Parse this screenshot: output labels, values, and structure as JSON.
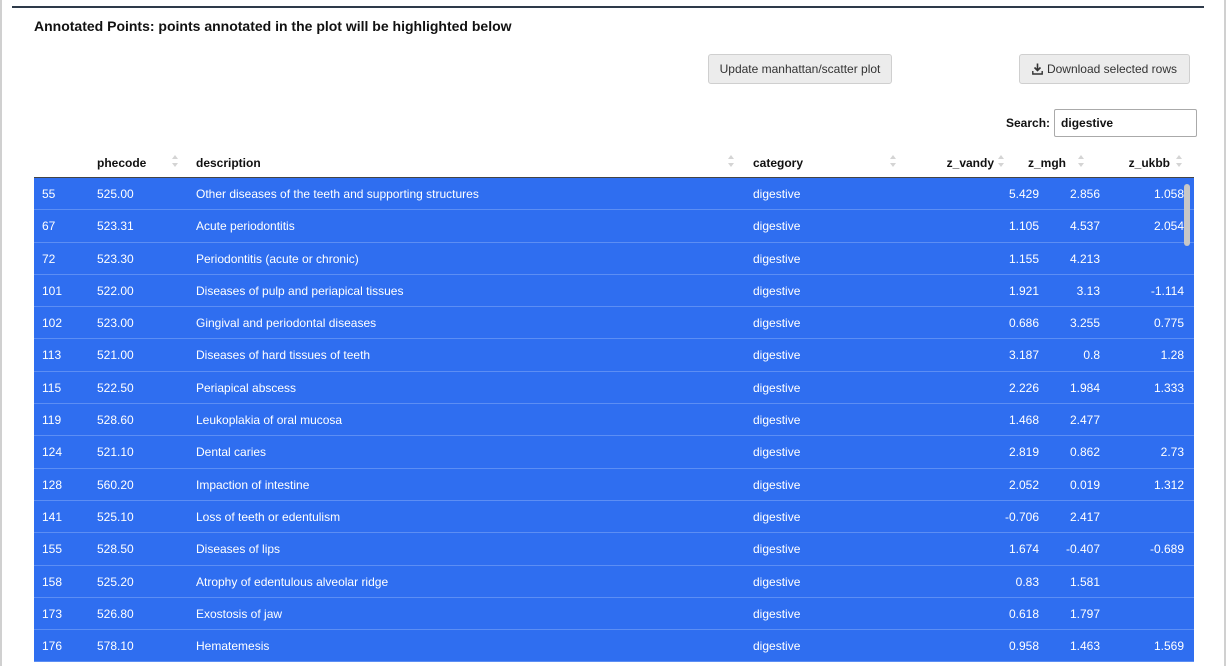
{
  "panel": {
    "title": "Annotated Points: points annotated in the plot will be highlighted below"
  },
  "buttons": {
    "update_label": "Update manhattan/scatter plot",
    "download_label": "Download selected rows"
  },
  "search": {
    "label": "Search:",
    "value": "digestive"
  },
  "table": {
    "headers": [
      "",
      "phecode",
      "description",
      "category",
      "z_vandy",
      "z_mgh",
      "z_ukbb"
    ],
    "rows": [
      [
        "55",
        "525.00",
        "Other diseases of the teeth and supporting structures",
        "digestive",
        "5.429",
        "2.856",
        "1.058"
      ],
      [
        "67",
        "523.31",
        "Acute periodontitis",
        "digestive",
        "1.105",
        "4.537",
        "2.054"
      ],
      [
        "72",
        "523.30",
        "Periodontitis (acute or chronic)",
        "digestive",
        "1.155",
        "4.213",
        ""
      ],
      [
        "101",
        "522.00",
        "Diseases of pulp and periapical tissues",
        "digestive",
        "1.921",
        "3.13",
        "-1.114"
      ],
      [
        "102",
        "523.00",
        "Gingival and periodontal diseases",
        "digestive",
        "0.686",
        "3.255",
        "0.775"
      ],
      [
        "113",
        "521.00",
        "Diseases of hard tissues of teeth",
        "digestive",
        "3.187",
        "0.8",
        "1.28"
      ],
      [
        "115",
        "522.50",
        "Periapical abscess",
        "digestive",
        "2.226",
        "1.984",
        "1.333"
      ],
      [
        "119",
        "528.60",
        "Leukoplakia of oral mucosa",
        "digestive",
        "1.468",
        "2.477",
        ""
      ],
      [
        "124",
        "521.10",
        "Dental caries",
        "digestive",
        "2.819",
        "0.862",
        "2.73"
      ],
      [
        "128",
        "560.20",
        "Impaction of intestine",
        "digestive",
        "2.052",
        "0.019",
        "1.312"
      ],
      [
        "141",
        "525.10",
        "Loss of teeth or edentulism",
        "digestive",
        "-0.706",
        "2.417",
        ""
      ],
      [
        "155",
        "528.50",
        "Diseases of lips",
        "digestive",
        "1.674",
        "-0.407",
        "-0.689"
      ],
      [
        "158",
        "525.20",
        "Atrophy of edentulous alveolar ridge",
        "digestive",
        "0.83",
        "1.581",
        ""
      ],
      [
        "173",
        "526.80",
        "Exostosis of jaw",
        "digestive",
        "0.618",
        "1.797",
        ""
      ],
      [
        "176",
        "578.10",
        "Hematemesis",
        "digestive",
        "0.958",
        "1.463",
        "1.569"
      ]
    ]
  },
  "colors": {
    "selected_row": "#2f6ef0",
    "header_rule": "#2e3a4a"
  }
}
